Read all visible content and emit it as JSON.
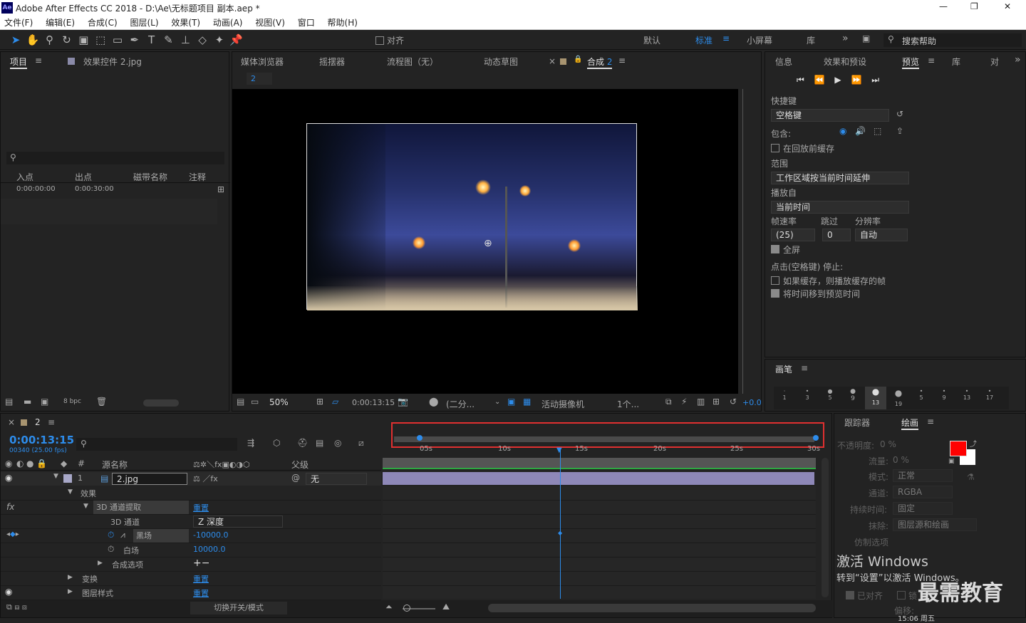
{
  "window": {
    "title": "Adobe After Effects CC 2018 - D:\\Ae\\无标题项目 副本.aep *",
    "logo": "Ae",
    "controls": [
      "—",
      "❐",
      "✕"
    ]
  },
  "menu": [
    "文件(F)",
    "编辑(E)",
    "合成(C)",
    "图层(L)",
    "效果(T)",
    "动画(A)",
    "视图(V)",
    "窗口",
    "帮助(H)"
  ],
  "toolbar": {
    "align_label": "对齐",
    "workspaces": [
      "默认",
      "标准",
      "小屏幕",
      "库"
    ],
    "active_workspace": "标准",
    "search_placeholder": "搜索帮助"
  },
  "project_panel": {
    "tab_project": "项目",
    "tab_effects": "效果控件 2.jpg",
    "cols": [
      "入点",
      "出点",
      "磁带名称",
      "注释"
    ],
    "row": {
      "in": "0:00:00:00",
      "out": "0:00:30:00"
    },
    "bpc": "8 bpc"
  },
  "viewer": {
    "tabs": [
      "媒体浏览器",
      "摇摆器",
      "流程图（无）",
      "动态草图"
    ],
    "comp_tab": "合成",
    "comp_num": "2",
    "breadcrumb": "2",
    "zoom": "50%",
    "timecode": "0:00:13:15",
    "resolution": "(二分...",
    "camera": "活动摄像机",
    "views": "1个...",
    "exposure": "+0.0"
  },
  "preview": {
    "tabs": [
      "信息",
      "效果和预设",
      "预览",
      "库",
      "对"
    ],
    "shortcut_label": "快捷键",
    "shortcut_value": "空格键",
    "include_label": "包含:",
    "cache_label": "在回放前缓存",
    "range_label": "范围",
    "range_value": "工作区域按当前时间延伸",
    "play_from_label": "播放自",
    "play_from_value": "当前时间",
    "fps_label": "帧速率",
    "skip_label": "跳过",
    "res_label": "分辨率",
    "fps_value": "(25)",
    "skip_value": "0",
    "res_value": "自动",
    "fullscreen_label": "全屏",
    "stop_label": "点击(空格键) 停止:",
    "opt1": "如果缓存，则播放缓存的帧",
    "opt2": "将时间移到预览时间"
  },
  "brush_panel": {
    "title": "画笔",
    "sizes": [
      "1",
      "3",
      "5",
      "9",
      "13",
      "19",
      "5",
      "9",
      "13",
      "17"
    ]
  },
  "timeline": {
    "comp_label": "2",
    "timecode": "0:00:13:15",
    "frames": "00340 (25.00 fps)",
    "ruler": [
      "05s",
      "10s",
      "15s",
      "20s",
      "25s",
      "30s"
    ],
    "col_source": "源名称",
    "col_parent": "父级",
    "layer_num": "1",
    "layer_name": "2.jpg",
    "parent_value": "无",
    "effects_label": "效果",
    "effect_name": "3D 通道提取",
    "reset": "重置",
    "channel_label": "3D 通道",
    "channel_value": "Z 深度",
    "black_label": "黑场",
    "black_value": "-10000.0",
    "white_label": "白场",
    "white_value": "10000.0",
    "composite_label": "合成选项",
    "transform_label": "变换",
    "layer_styles_label": "图层样式",
    "toggle_label": "切换开关/模式"
  },
  "tracker": {
    "tabs": [
      "跟踪器",
      "绘画"
    ],
    "opacity_label": "不透明度:",
    "opacity_value": "0 %",
    "flow_label": "流量:",
    "flow_value": "0 %",
    "mode_label": "模式:",
    "mode_value": "正常",
    "channel_label": "通道:",
    "channel_value": "RGBA",
    "duration_label": "持续时间:",
    "duration_value": "固定",
    "erase_label": "抹除:",
    "erase_value": "图层源和绘画",
    "clone_label": "仿制选项",
    "align_label": "已对齐",
    "lock_label": "锁",
    "offset_label": "偏移:",
    "fg_color": "#ff0000",
    "bg_color": "#ffffff"
  },
  "watermark": {
    "line1": "激活 Windows",
    "line2": "转到“设置”以激活 Windows。",
    "brand": "最需教育"
  },
  "clock": "15:06 周五"
}
